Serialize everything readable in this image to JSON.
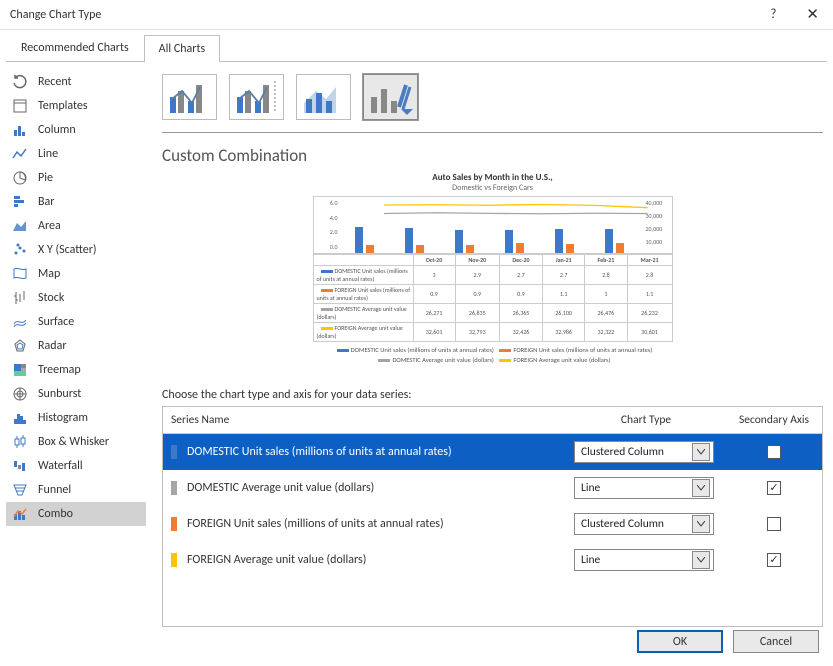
{
  "title": "Change Chart Type",
  "titlectrl": {
    "help": "?",
    "close": "✕"
  },
  "tabs": {
    "recommended": "Recommended Charts",
    "all": "All Charts"
  },
  "sidebar": {
    "items": [
      {
        "label": "Recent",
        "icon": "recent-icon"
      },
      {
        "label": "Templates",
        "icon": "templates-icon"
      },
      {
        "label": "Column",
        "icon": "column-icon"
      },
      {
        "label": "Line",
        "icon": "line-icon"
      },
      {
        "label": "Pie",
        "icon": "pie-icon"
      },
      {
        "label": "Bar",
        "icon": "bar-icon"
      },
      {
        "label": "Area",
        "icon": "area-icon"
      },
      {
        "label": "X Y (Scatter)",
        "icon": "scatter-icon"
      },
      {
        "label": "Map",
        "icon": "map-icon"
      },
      {
        "label": "Stock",
        "icon": "stock-icon"
      },
      {
        "label": "Surface",
        "icon": "surface-icon"
      },
      {
        "label": "Radar",
        "icon": "radar-icon"
      },
      {
        "label": "Treemap",
        "icon": "treemap-icon"
      },
      {
        "label": "Sunburst",
        "icon": "sunburst-icon"
      },
      {
        "label": "Histogram",
        "icon": "histogram-icon"
      },
      {
        "label": "Box & Whisker",
        "icon": "box-icon"
      },
      {
        "label": "Waterfall",
        "icon": "waterfall-icon"
      },
      {
        "label": "Funnel",
        "icon": "funnel-icon"
      },
      {
        "label": "Combo",
        "icon": "combo-icon"
      }
    ],
    "selected": 18
  },
  "subtype": {
    "selected": 3
  },
  "heading": "Custom Combination",
  "preview": {
    "title": "Auto Sales by Month in the U.S.,",
    "subtitle": "Domestic vs Foreign Cars",
    "y1": {
      "max": 6.0,
      "ticks": [
        "6.0",
        "4.0",
        "2.0",
        "0.0"
      ]
    },
    "y2": {
      "ticks": [
        "40,000",
        "30,000",
        "20,000",
        "10,000",
        ""
      ]
    },
    "legend": {
      "s1": "DOMESTIC Unit sales (millions of units at annual rates)",
      "s2": "FOREIGN Unit sales (millions of units at annual rates)",
      "s3": "DOMESTIC Average unit value (dollars)",
      "s4": "FOREIGN Average unit value (dollars)"
    }
  },
  "chart_data": {
    "type": "combo",
    "categories": [
      "Oct-20",
      "Nov-20",
      "Dec-20",
      "Jan-21",
      "Feb-21",
      "Mar-21"
    ],
    "series": [
      {
        "name": "DOMESTIC Unit sales (millions of units at annual rates)",
        "type": "bar",
        "axis": "primary",
        "color": "#3e78c8",
        "values": [
          3.0,
          2.9,
          2.7,
          2.7,
          2.8,
          2.8
        ]
      },
      {
        "name": "FOREIGN Unit sales (millions of units at annual rates)",
        "type": "bar",
        "axis": "primary",
        "color": "#ed7d31",
        "values": [
          0.9,
          0.9,
          0.9,
          1.1,
          1.0,
          1.1
        ]
      },
      {
        "name": "DOMESTIC Average unit value (dollars)",
        "type": "line",
        "axis": "secondary",
        "color": "#a6a6a6",
        "values": [
          26271,
          26835,
          26365,
          26100,
          26476,
          26232
        ]
      },
      {
        "name": "FOREIGN Average unit value (dollars)",
        "type": "line",
        "axis": "secondary",
        "color": "#ffc400",
        "values": [
          32601,
          32793,
          32426,
          32986,
          32322,
          30601
        ]
      }
    ],
    "ylabel": "",
    "ylim_primary": [
      0.0,
      6.0
    ],
    "ylim_secondary": [
      0,
      40000
    ]
  },
  "choose_label": "Choose the chart type and axis for your data series:",
  "series_table": {
    "headers": {
      "name": "Series Name",
      "type": "Chart Type",
      "axis": "Secondary Axis"
    },
    "rows": [
      {
        "swatch": "#3e78c8",
        "name": "DOMESTIC Unit sales (millions of units at annual rates)",
        "type": "Clustered Column",
        "secondary": false
      },
      {
        "swatch": "#a6a6a6",
        "name": "DOMESTIC Average unit value (dollars)",
        "type": "Line",
        "secondary": true
      },
      {
        "swatch": "#ed7d31",
        "name": "FOREIGN Unit sales (millions of units at annual rates)",
        "type": "Clustered Column",
        "secondary": false
      },
      {
        "swatch": "#ffc400",
        "name": "FOREIGN Average unit value (dollars)",
        "type": "Line",
        "secondary": true
      }
    ],
    "selected": 0
  },
  "footer": {
    "ok": "OK",
    "cancel": "Cancel"
  }
}
